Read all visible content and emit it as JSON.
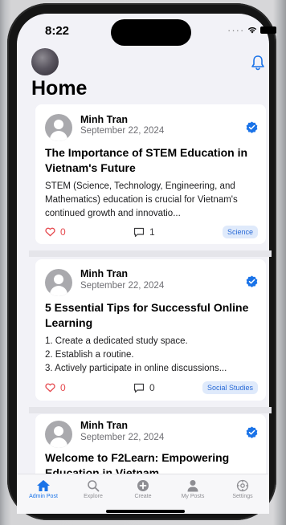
{
  "status": {
    "time": "8:22"
  },
  "header": {
    "title": "Home"
  },
  "posts": [
    {
      "author": "Minh Tran",
      "date": "September 22, 2024",
      "title": "The Importance of STEM Education in Vietnam's Future",
      "excerpt": "STEM (Science, Technology, Engineering, and Mathematics) education is crucial for Vietnam's continued growth and innovatio...",
      "likes": "0",
      "comments": "1",
      "tag": "Science"
    },
    {
      "author": "Minh Tran",
      "date": "September 22, 2024",
      "title": "5 Essential Tips for Successful Online Learning",
      "excerpt": "1. Create a dedicated study space.\n2. Establish a routine.\n3. Actively participate in online discussions...",
      "likes": "0",
      "comments": "0",
      "tag": "Social Studies"
    },
    {
      "author": "Minh Tran",
      "date": "September 22, 2024",
      "title": "Welcome to F2Learn: Empowering Education in Vietnam"
    }
  ],
  "tabs": [
    {
      "label": "Admin Post",
      "icon": "home-icon",
      "active": true
    },
    {
      "label": "Explore",
      "icon": "search-icon"
    },
    {
      "label": "Create",
      "icon": "plus-circle-icon"
    },
    {
      "label": "My Posts",
      "icon": "person-icon"
    },
    {
      "label": "Settings",
      "icon": "gear-icon"
    }
  ],
  "colors": {
    "accent": "#1a73e8",
    "like": "#e5484d",
    "tag_bg": "#dfeafb"
  }
}
